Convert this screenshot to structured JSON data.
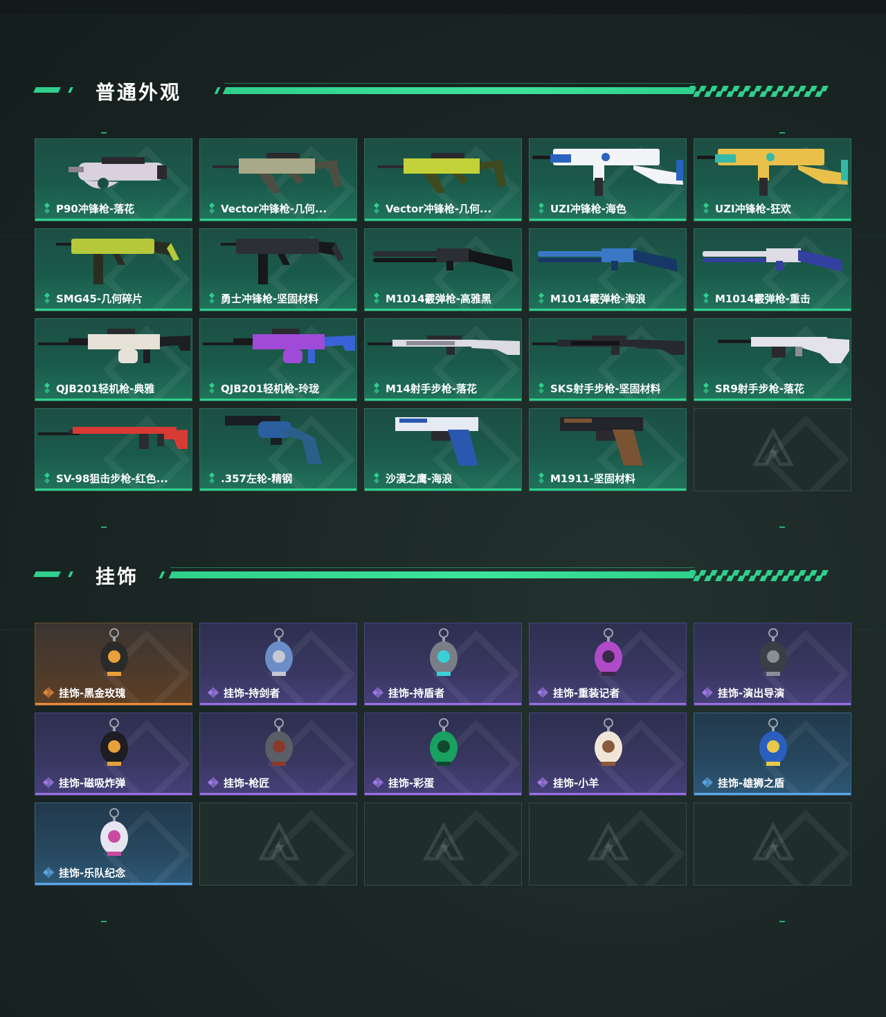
{
  "sections": [
    {
      "title": "普通外观",
      "items": [
        {
          "label": "P90冲锋枪-落花",
          "tier": "green",
          "art": "p90-icon",
          "c1": "#d9d2de",
          "c2": "#8a8590"
        },
        {
          "label": "Vector冲锋枪-几何...",
          "tier": "green",
          "art": "vector-icon",
          "c1": "#a8a88a",
          "c2": "#4b4e40"
        },
        {
          "label": "Vector冲锋枪-几何...",
          "tier": "green",
          "art": "vector-icon",
          "c1": "#c4d23a",
          "c2": "#3e4a20"
        },
        {
          "label": "UZI冲锋枪-海色",
          "tier": "green",
          "art": "uzi-icon",
          "c1": "#f2f4f8",
          "c2": "#2a62c0"
        },
        {
          "label": "UZI冲锋枪-狂欢",
          "tier": "green",
          "art": "uzi-icon",
          "c1": "#e8c04a",
          "c2": "#35b9a6"
        },
        {
          "label": "SMG45-几何碎片",
          "tier": "green",
          "art": "smg-icon",
          "c1": "#b6c93a",
          "c2": "#2a2e22"
        },
        {
          "label": "勇士冲锋枪-坚固材料",
          "tier": "green",
          "art": "smg-icon",
          "c1": "#2c2f33",
          "c2": "#16181a"
        },
        {
          "label": "M1014霰弹枪-高雅黑",
          "tier": "green",
          "art": "shotgun-icon",
          "c1": "#2b2e32",
          "c2": "#141618"
        },
        {
          "label": "M1014霰弹枪-海浪",
          "tier": "green",
          "art": "shotgun-icon",
          "c1": "#3a78c6",
          "c2": "#173766"
        },
        {
          "label": "M1014霰弹枪-重击",
          "tier": "green",
          "art": "shotgun-icon",
          "c1": "#dedde6",
          "c2": "#3440a0"
        },
        {
          "label": "QJB201轻机枪-典雅",
          "tier": "green",
          "art": "lmg-icon",
          "c1": "#e6e2d8",
          "c2": "#1d1f22"
        },
        {
          "label": "QJB201轻机枪-玲珑",
          "tier": "green",
          "art": "lmg-icon",
          "c1": "#a04ad8",
          "c2": "#3a62d8"
        },
        {
          "label": "M14射手步枪-落花",
          "tier": "green",
          "art": "rifle-icon",
          "c1": "#dcdbe2",
          "c2": "#8d8b96"
        },
        {
          "label": "SKS射手步枪-坚固材料",
          "tier": "green",
          "art": "rifle-icon",
          "c1": "#26292d",
          "c2": "#111315"
        },
        {
          "label": "SR9射手步枪-落花",
          "tier": "green",
          "art": "sr9-icon",
          "c1": "#e4e3ea",
          "c2": "#8e8c99"
        },
        {
          "label": "SV-98狙击步枪-红色...",
          "tier": "green",
          "art": "sniper-icon",
          "c1": "#d83a34",
          "c2": "#2a2c30"
        },
        {
          "label": ".357左轮-精钢",
          "tier": "green",
          "art": "revolver-icon",
          "c1": "#2a5fa0",
          "c2": "#1a1d24"
        },
        {
          "label": "沙漠之鹰-海浪",
          "tier": "green",
          "art": "pistol-icon",
          "c1": "#e6eaf2",
          "c2": "#2a58b0"
        },
        {
          "label": "M1911-坚固材料",
          "tier": "green",
          "art": "pistol-icon",
          "c1": "#222529",
          "c2": "#7a5234"
        },
        {
          "label": "",
          "tier": "empty",
          "art": "logo-icon"
        }
      ]
    },
    {
      "title": "挂饰",
      "items": [
        {
          "label": "挂饰-黑金玫瑰",
          "tier": "orange",
          "art": "charm-icon",
          "c1": "#2a2a2a",
          "c2": "#e8a03a"
        },
        {
          "label": "挂饰-持剑者",
          "tier": "purple",
          "art": "charm-icon",
          "c1": "#6b8ec8",
          "c2": "#c8c8d4"
        },
        {
          "label": "挂饰-持盾者",
          "tier": "purple",
          "art": "charm-icon",
          "c1": "#7a7e86",
          "c2": "#3ad0d8"
        },
        {
          "label": "挂饰-重装记者",
          "tier": "purple",
          "art": "charm-icon",
          "c1": "#b04ac8",
          "c2": "#3a2a4a"
        },
        {
          "label": "挂饰-演出导演",
          "tier": "purple",
          "art": "charm-icon",
          "c1": "#3a3f46",
          "c2": "#8a8f96"
        },
        {
          "label": "挂饰-磁吸炸弹",
          "tier": "purple",
          "art": "charm-icon",
          "c1": "#1d1d22",
          "c2": "#e8a03a"
        },
        {
          "label": "挂饰-枪匠",
          "tier": "purple",
          "art": "charm-icon",
          "c1": "#5a5e66",
          "c2": "#8a3a2a"
        },
        {
          "label": "挂饰-彩蛋",
          "tier": "purple",
          "art": "charm-icon",
          "c1": "#1aa060",
          "c2": "#0d4a30"
        },
        {
          "label": "挂饰-小羊",
          "tier": "purple",
          "art": "charm-icon",
          "c1": "#f0e6d8",
          "c2": "#8a5a3a"
        },
        {
          "label": "挂饰-雄狮之盾",
          "tier": "blue",
          "art": "charm-icon",
          "c1": "#2a5fc0",
          "c2": "#e8c84a"
        },
        {
          "label": "挂饰-乐队纪念",
          "tier": "blue",
          "art": "charm-icon",
          "c1": "#e6e6f0",
          "c2": "#c84aa0"
        },
        {
          "label": "",
          "tier": "empty",
          "art": "logo-icon"
        },
        {
          "label": "",
          "tier": "empty",
          "art": "logo-icon"
        },
        {
          "label": "",
          "tier": "empty",
          "art": "logo-icon"
        },
        {
          "label": "",
          "tier": "empty",
          "art": "logo-icon"
        }
      ]
    }
  ],
  "colors": {
    "accent": "#2fd08c",
    "green_tier": "#2fd08c",
    "purple_tier": "#9a6ee0",
    "blue_tier": "#5aa6e8",
    "orange_tier": "#e88a3a"
  }
}
